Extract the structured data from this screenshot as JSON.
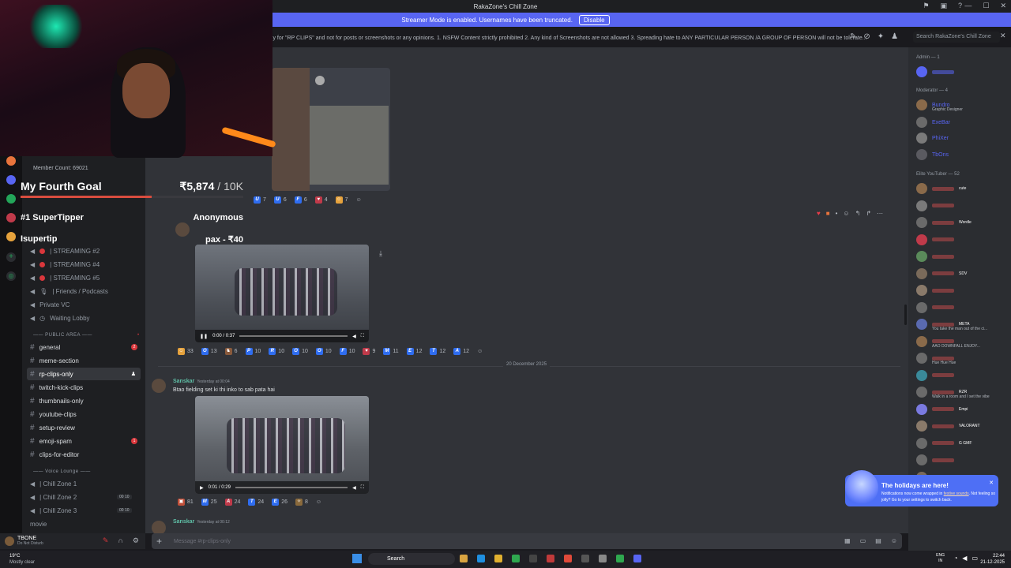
{
  "window": {
    "title": "RakaZone's Chill Zone",
    "controls": [
      "—",
      "☐",
      "✕"
    ]
  },
  "streamer_banner": {
    "text": "Streamer Mode is enabled. Usernames have been truncated.",
    "button": "Disable"
  },
  "topic": "nly for \"RP CLIPS\" and not for posts or screenshots or any opinions. 1. NSFW Content strictly prohibited 2. Any kind of Screenshots are not allowed 3. Spreading hate to ANY PARTICULAR PERSON /A GROUP OF PERSON will not be tolerate...",
  "search": {
    "placeholder": "Search RakaZone's Chill Zone"
  },
  "overlay": {
    "member_count": "Member Count: 69021",
    "goal_title": "My Fourth Goal",
    "goal_amount": "₹5,874",
    "goal_target": "/ 10K",
    "goal_progress": 0.5874,
    "tipper_label": "#1 SuperTipper",
    "tipper_value": "Anonymous",
    "isupertip_label": "Isupertip",
    "isupertip_value": "pax - ₹40"
  },
  "channels": {
    "voice_top": [
      "| STREAMING #2",
      "| STREAMING #4",
      "| STREAMING #5",
      "| Friends / Podcasts",
      "Private VC",
      "Waiting Lobby"
    ],
    "public_area": "PUBLIC AREA",
    "text": [
      {
        "name": "general",
        "badge": "2"
      },
      {
        "name": "meme-section",
        "badge": ""
      },
      {
        "name": "rp-clips-only",
        "badge": ""
      },
      {
        "name": "twitch-kick-clips",
        "badge": ""
      },
      {
        "name": "thumbnails-only",
        "badge": ""
      },
      {
        "name": "youtube-clips",
        "badge": ""
      },
      {
        "name": "setup-review",
        "badge": ""
      },
      {
        "name": "emoji-spam",
        "badge": "1"
      },
      {
        "name": "clips-for-editor",
        "badge": ""
      }
    ],
    "voice_lounge": "Voice Lounge",
    "voice_bottom": [
      {
        "name": "| Chill Zone 1",
        "pills": ""
      },
      {
        "name": "| Chill Zone 2",
        "pills": "00  10"
      },
      {
        "name": "| Chill Zone 3",
        "pills": "00  10"
      },
      {
        "name": "movie",
        "pills": ""
      }
    ]
  },
  "user": {
    "name": "TBONE",
    "status": "Do Not Disturb"
  },
  "messages": {
    "top_reactions": [
      "7",
      "6",
      "6",
      "4",
      "7"
    ],
    "video1": {
      "time": "0:00 / 0:37"
    },
    "video1_reactions": [
      "33",
      "13",
      "6",
      "10",
      "10",
      "10",
      "10",
      "10",
      "9",
      "11",
      "12",
      "12",
      "12"
    ],
    "date_divider": "20 December 2025",
    "msg2": {
      "author": "Sanskar",
      "time": "Yesterday at 00:04",
      "text": "Btao fielding set ki thi inko to sab pata hai"
    },
    "video2": {
      "time": "0:01 / 0:29"
    },
    "video2_reactions": [
      "81",
      "25",
      "24",
      "24",
      "26",
      "8"
    ],
    "msg3": {
      "author": "Sanskar",
      "time": "Yesterday at 00:12"
    }
  },
  "composer": {
    "placeholder": "Message #rp-clips-only"
  },
  "members": {
    "admin_header": "Admin — 1",
    "moderator_header": "Moderator — 4",
    "moderators": [
      {
        "name": "Bundro",
        "sub": "Graphic Designer"
      },
      {
        "name": "ExeBar",
        "sub": ""
      },
      {
        "name": "PhiXer",
        "sub": ""
      },
      {
        "name": "TbOns",
        "sub": ""
      }
    ],
    "elite_header": "Elite YouTuber — 52",
    "elite_tags": [
      "cute",
      "",
      "Wordle",
      "",
      "",
      "SDV",
      "",
      "",
      "META",
      "",
      "",
      "",
      "RZR",
      "Empi",
      "VALORANT",
      "G GMF",
      "",
      "",
      "R/SC"
    ],
    "elite_subs": [
      "",
      "",
      "",
      "",
      "",
      "",
      "",
      "",
      "You take the man out of the ci...",
      "AAO DOWNFALL ENJOY...",
      "Hue Hue Hue",
      "",
      "Walk in a room and I set the vibe",
      "",
      "",
      "",
      "",
      "",
      ""
    ]
  },
  "holiday": {
    "title": "The holidays are here!",
    "body_pre": "Notifications now come wrapped in ",
    "body_link": "festive sounds",
    "body_post": ". Not feeling so jolly? Go to your settings to switch back."
  },
  "taskbar": {
    "temp": "19°C",
    "weather": "Mostly clear",
    "search": "Search",
    "lang1": "ENG",
    "lang2": "IN",
    "time": "22:44",
    "date": "21-12-2025"
  }
}
